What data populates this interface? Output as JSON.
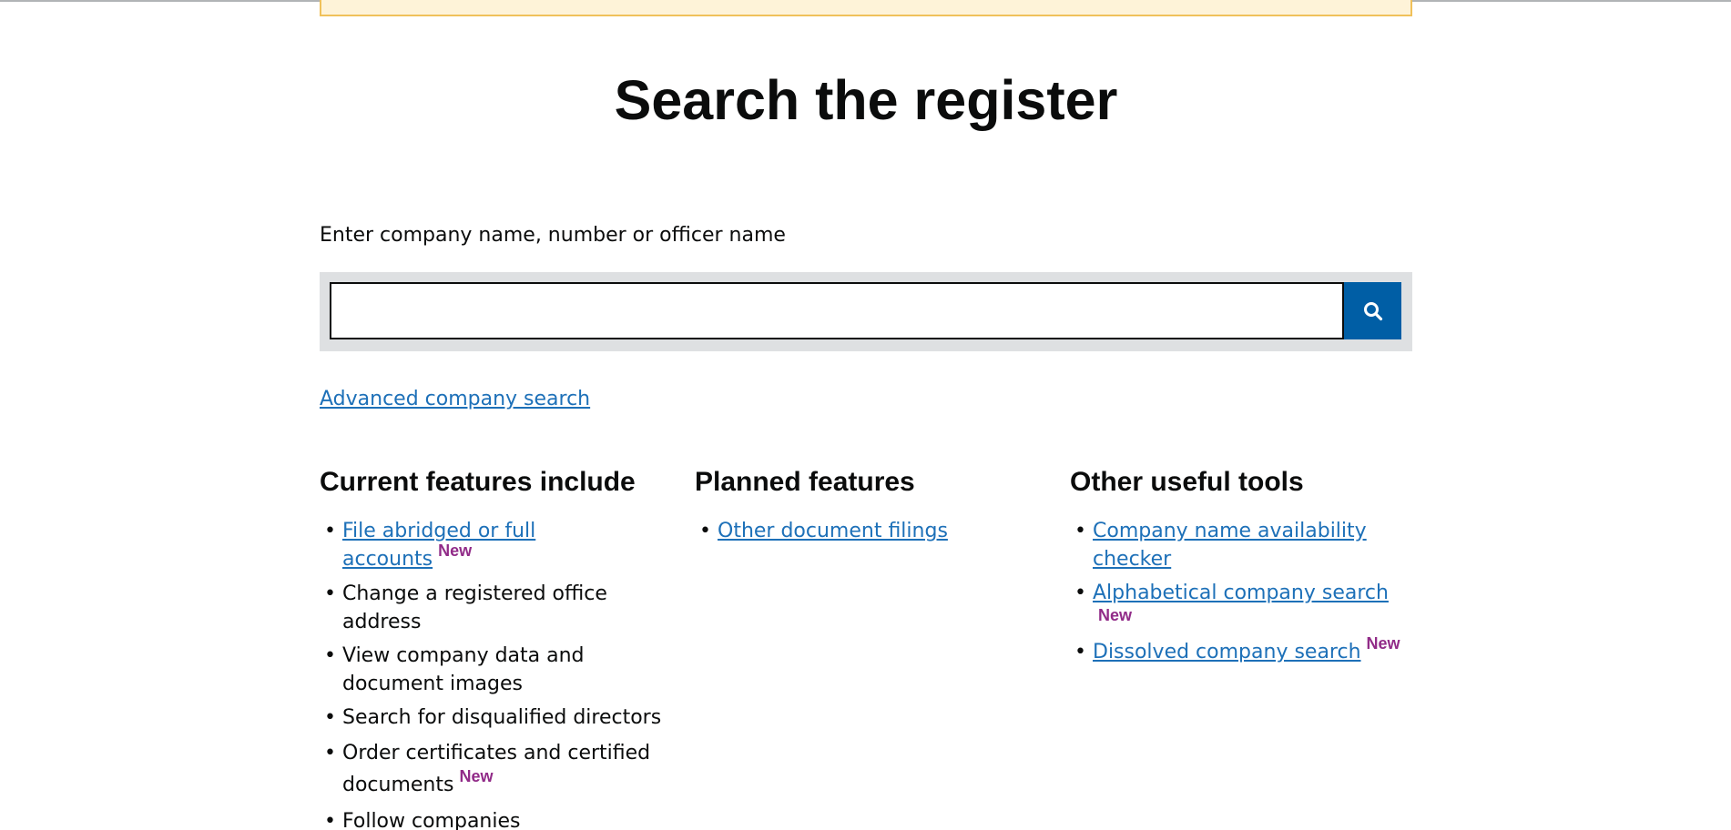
{
  "page": {
    "title": "Search the register"
  },
  "search": {
    "label": "Enter company name, number or officer name",
    "input_value": "",
    "button_icon": "search-icon"
  },
  "advanced_link": "Advanced company search",
  "badge_text": "New",
  "current": {
    "heading": "Current features include",
    "items": [
      {
        "label": "File abridged or full accounts",
        "link": true,
        "new": true
      },
      {
        "label": "Change a registered office address",
        "link": false,
        "new": false
      },
      {
        "label": "View company data and document images",
        "link": false,
        "new": false
      },
      {
        "label": "Search for disqualified directors",
        "link": false,
        "new": false
      },
      {
        "label": "Order certificates and certified documents",
        "link": false,
        "new": true
      },
      {
        "label": "Follow companies",
        "link": false,
        "new": false
      }
    ]
  },
  "planned": {
    "heading": "Planned features",
    "items": [
      {
        "label": "Other document filings",
        "link": true,
        "new": false
      }
    ]
  },
  "tools": {
    "heading": "Other useful tools",
    "items": [
      {
        "label": "Company name availability checker",
        "link": true,
        "new": false
      },
      {
        "label": "Alphabetical company search",
        "link": true,
        "new": true
      },
      {
        "label": "Dissolved company search",
        "link": true,
        "new": true
      }
    ]
  },
  "colors": {
    "link": "#1d70b8",
    "badge": "#912b88",
    "search_button": "#005ea5",
    "search_band": "#dee0e2",
    "warning_bg": "#fef3d8",
    "warning_border": "#f0c15a"
  }
}
